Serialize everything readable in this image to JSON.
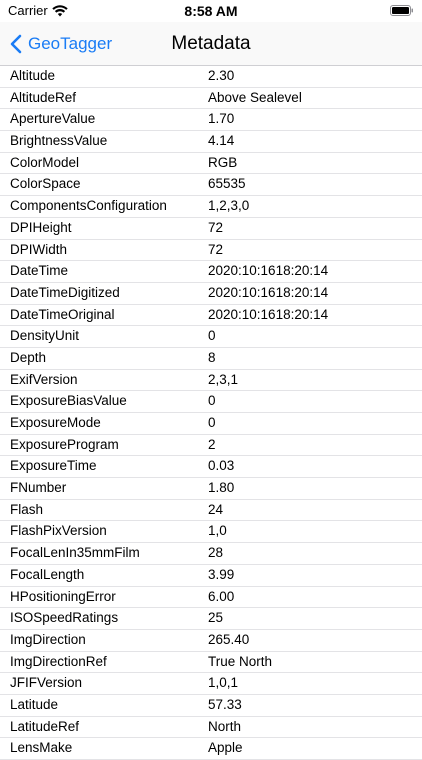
{
  "status_bar": {
    "carrier": "Carrier",
    "time": "8:58 AM"
  },
  "nav": {
    "back_label": "GeoTagger",
    "title": "Metadata"
  },
  "colors": {
    "accent": "#1a7cf5"
  },
  "rows": [
    {
      "key": "Altitude",
      "value": "2.30"
    },
    {
      "key": "AltitudeRef",
      "value": "Above Sealevel"
    },
    {
      "key": "ApertureValue",
      "value": "1.70"
    },
    {
      "key": "BrightnessValue",
      "value": "4.14"
    },
    {
      "key": "ColorModel",
      "value": "RGB"
    },
    {
      "key": "ColorSpace",
      "value": "65535"
    },
    {
      "key": "ComponentsConfiguration",
      "value": "1,2,3,0"
    },
    {
      "key": "DPIHeight",
      "value": "72"
    },
    {
      "key": "DPIWidth",
      "value": "72"
    },
    {
      "key": "DateTime",
      "value": "2020:10:1618:20:14"
    },
    {
      "key": "DateTimeDigitized",
      "value": "2020:10:1618:20:14"
    },
    {
      "key": "DateTimeOriginal",
      "value": "2020:10:1618:20:14"
    },
    {
      "key": "DensityUnit",
      "value": "0"
    },
    {
      "key": "Depth",
      "value": "8"
    },
    {
      "key": "ExifVersion",
      "value": "2,3,1"
    },
    {
      "key": "ExposureBiasValue",
      "value": "0"
    },
    {
      "key": "ExposureMode",
      "value": "0"
    },
    {
      "key": "ExposureProgram",
      "value": "2"
    },
    {
      "key": "ExposureTime",
      "value": "0.03"
    },
    {
      "key": "FNumber",
      "value": "1.80"
    },
    {
      "key": "Flash",
      "value": "24"
    },
    {
      "key": "FlashPixVersion",
      "value": "1,0"
    },
    {
      "key": "FocalLenIn35mmFilm",
      "value": "28"
    },
    {
      "key": "FocalLength",
      "value": "3.99"
    },
    {
      "key": "HPositioningError",
      "value": "6.00"
    },
    {
      "key": "ISOSpeedRatings",
      "value": "25"
    },
    {
      "key": "ImgDirection",
      "value": "265.40"
    },
    {
      "key": "ImgDirectionRef",
      "value": "True North"
    },
    {
      "key": "JFIFVersion",
      "value": "1,0,1"
    },
    {
      "key": "Latitude",
      "value": "57.33"
    },
    {
      "key": "LatitudeRef",
      "value": "North"
    },
    {
      "key": "LensMake",
      "value": "Apple"
    }
  ]
}
